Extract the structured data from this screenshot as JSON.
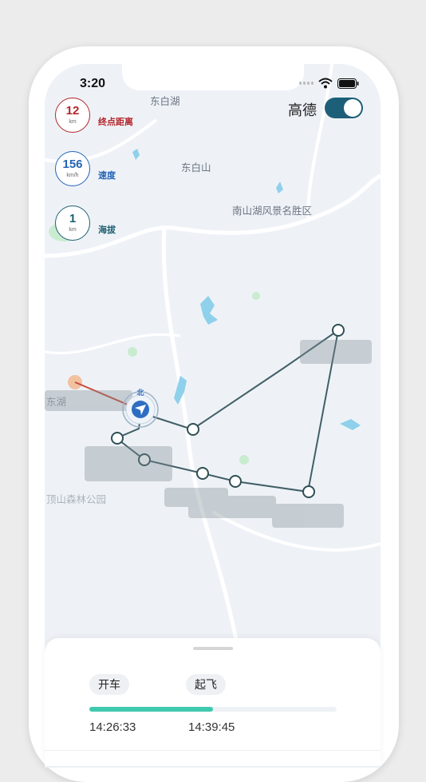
{
  "status_bar": {
    "time": "3:20"
  },
  "map": {
    "labels": [
      "东白湖",
      "东白山",
      "南山湖风景名胜区",
      "顶山森林公园",
      "东湖"
    ],
    "compass_label": "北"
  },
  "gauges": [
    {
      "value": "12",
      "unit": "km",
      "label": "终点距离",
      "color": "#b3262b"
    },
    {
      "value": "156",
      "unit": "km/h",
      "label": "速度",
      "color": "#2565b5"
    },
    {
      "value": "1",
      "unit": "km",
      "label": "海拔",
      "color": "#1e6070"
    }
  ],
  "map_provider_toggle": {
    "label": "高德",
    "on": true
  },
  "bottom_sheet": {
    "modes": [
      "开车",
      "起飞"
    ],
    "progress_fraction": 0.5,
    "times": [
      "14:26:33",
      "14:39:45"
    ]
  },
  "colors": {
    "route": "#2e4f55",
    "accent": "#3fc9ae",
    "toggle": "#1d5f78"
  }
}
